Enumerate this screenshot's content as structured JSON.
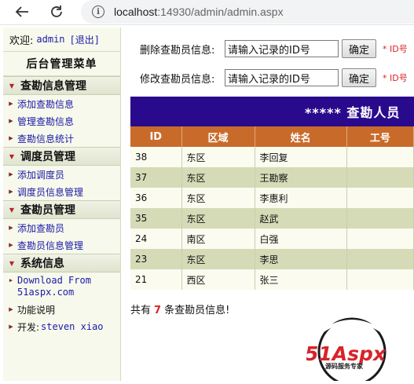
{
  "browser": {
    "url_host": "localhost",
    "url_path": ":14930/admin/admin.aspx"
  },
  "sidebar": {
    "welcome_label": "欢迎:",
    "username": "admin",
    "logout": "[退出]",
    "menu_title": "后台管理菜单",
    "groups": [
      {
        "title": "查勘信息管理",
        "items": [
          "添加查勘信息",
          "管理查勘信息",
          "查勘信息统计"
        ]
      },
      {
        "title": "调度员管理",
        "items": [
          "添加调度员",
          "调度员信息管理"
        ]
      },
      {
        "title": "查勘员管理",
        "items": [
          "添加查勘员",
          "查勘员信息管理"
        ]
      },
      {
        "title": "系统信息",
        "items": []
      }
    ],
    "sys_download": "Download From 51aspx.com",
    "sys_help": "功能说明",
    "sys_dev_label": "开发:",
    "sys_dev_name": "steven xiao"
  },
  "forms": {
    "delete": {
      "label": "删除查勘员信息:",
      "value": "请输入记录的ID号",
      "button": "确定",
      "hint": "* ID号"
    },
    "modify": {
      "label": "修改查勘员信息:",
      "value": "请输入记录的ID号",
      "button": "确定",
      "hint": "* ID号"
    }
  },
  "banner": "***** 查勘人员",
  "table": {
    "headers": [
      "ID",
      "区域",
      "姓名",
      "工号"
    ],
    "rows": [
      [
        "38",
        "东区",
        "李回复",
        ""
      ],
      [
        "37",
        "东区",
        "王勘察",
        ""
      ],
      [
        "36",
        "东区",
        "李惠利",
        ""
      ],
      [
        "35",
        "东区",
        "赵武",
        ""
      ],
      [
        "24",
        "南区",
        "白强",
        ""
      ],
      [
        "23",
        "东区",
        "李思",
        ""
      ],
      [
        "21",
        "西区",
        "张三",
        ""
      ]
    ]
  },
  "summary": {
    "prefix": "共有",
    "count": "7",
    "suffix": "条查勘员信息!"
  },
  "logo": {
    "brand": "51Aspx",
    "tagline": "源码服务专家"
  },
  "colors": {
    "banner_bg": "#2a0a8c",
    "header_bg": "#c86b2a",
    "row_alt": "#d5dbb6",
    "link": "#1a1aa6",
    "hint_red": "#dd2222"
  },
  "icons": [
    "back-arrow-icon",
    "reload-icon",
    "info-icon",
    "caret-down-icon",
    "bullet-triangle-icon"
  ]
}
